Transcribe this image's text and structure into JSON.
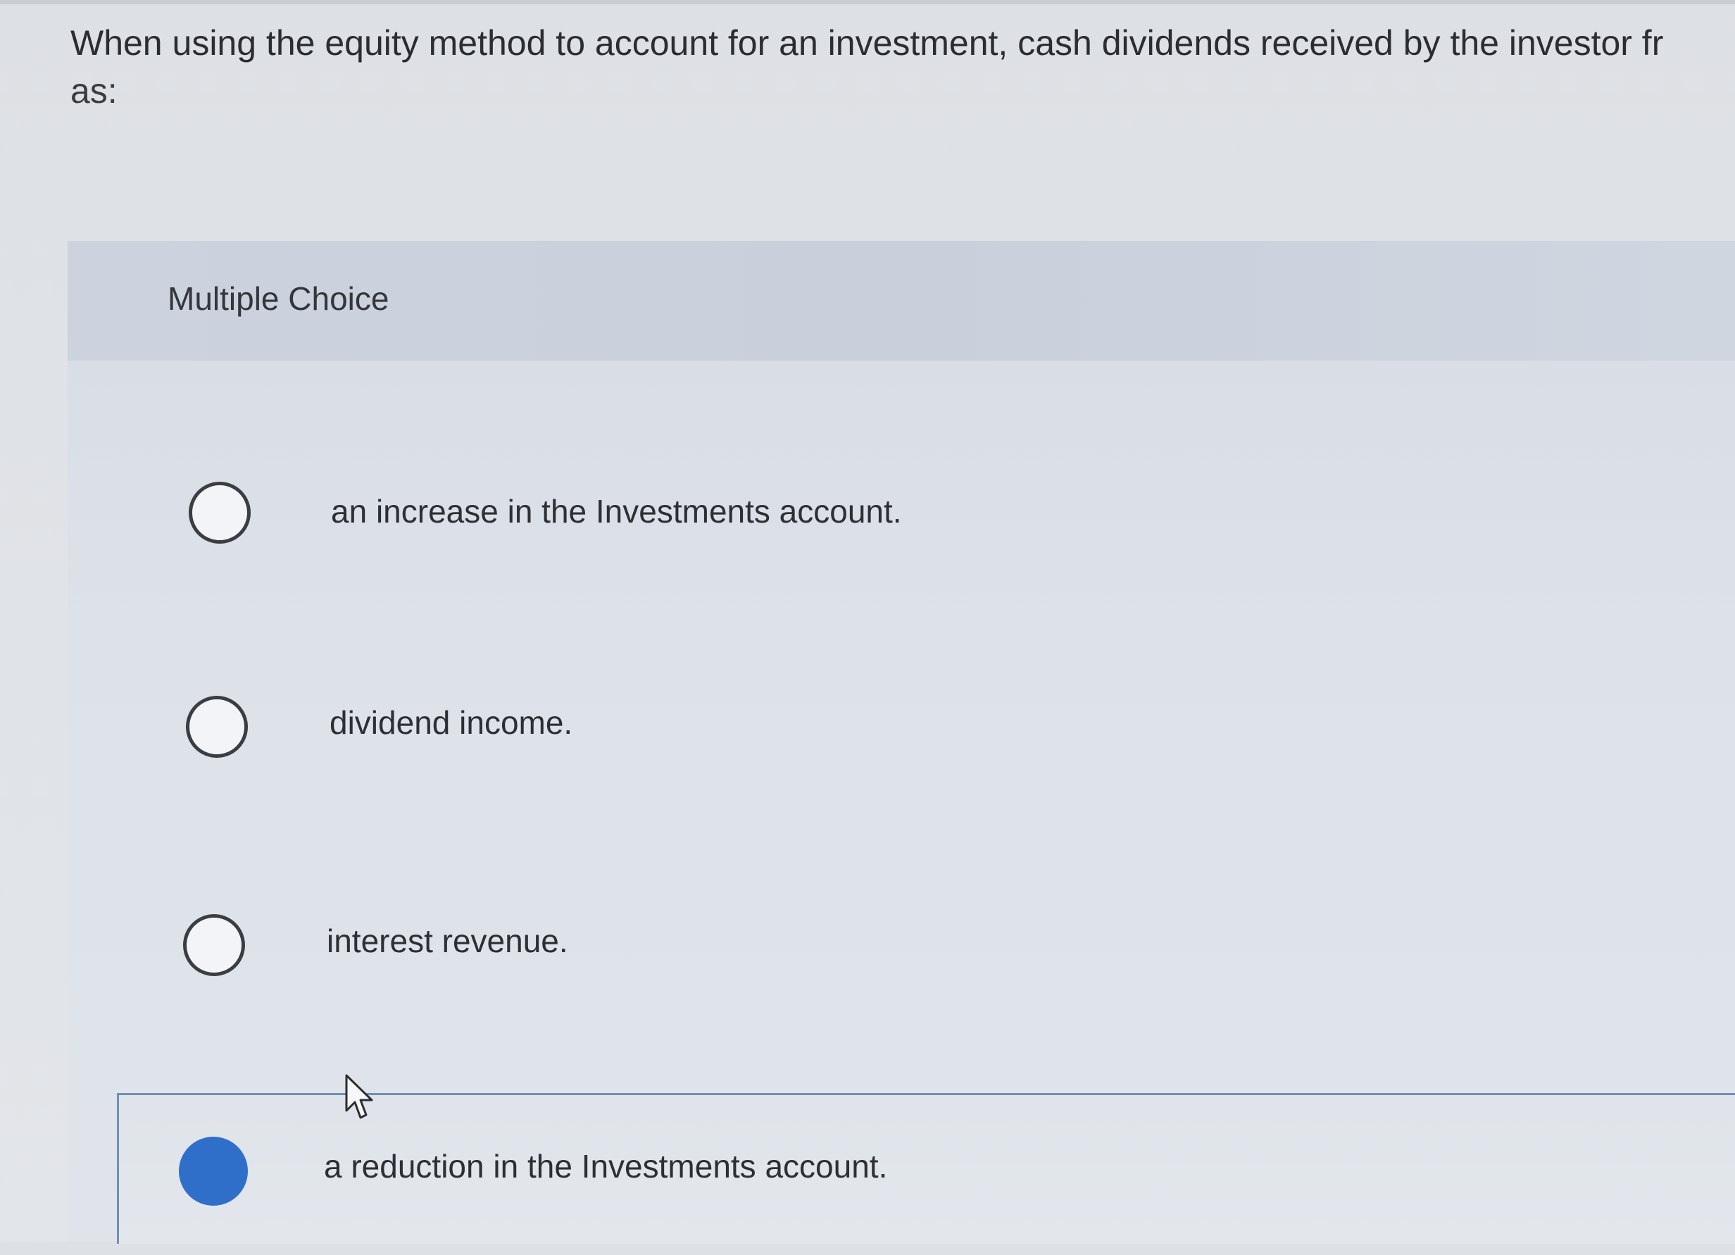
{
  "question": {
    "line1": "When using the equity method to account for an investment, cash dividends received by the investor fr",
    "line2": "as:"
  },
  "multiple_choice": {
    "title": "Multiple Choice",
    "options": [
      {
        "label": "an increase in the Investments account.",
        "selected": false
      },
      {
        "label": "dividend income.",
        "selected": false
      },
      {
        "label": "interest revenue.",
        "selected": false
      },
      {
        "label": "a reduction in the Investments account.",
        "selected": true
      }
    ]
  },
  "colors": {
    "selected_radio": "#2f6fca",
    "panel_header": "#c8d0dc",
    "selected_border": "#6f8fb8"
  }
}
